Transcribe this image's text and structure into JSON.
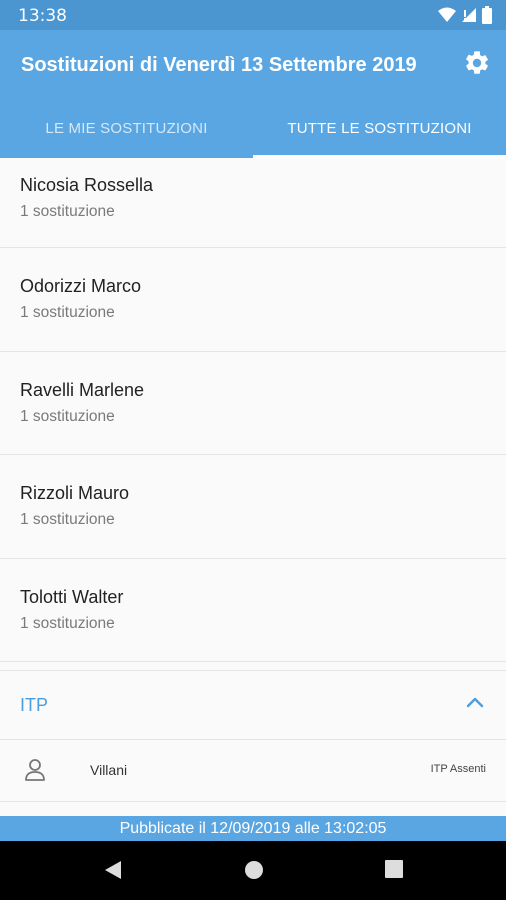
{
  "status_bar": {
    "time": "13:38",
    "icons": [
      "wifi-icon",
      "signal-icon",
      "battery-icon"
    ]
  },
  "app_bar": {
    "title": "Sostituzioni di Venerdì 13 Settembre 2019",
    "settings_icon": "gear-icon"
  },
  "tabs": [
    {
      "label": "LE MIE SOSTITUZIONI",
      "active": false
    },
    {
      "label": "TUTTE LE SOSTITUZIONI",
      "active": true
    }
  ],
  "teachers": [
    {
      "name": "Nicosia  Rossella",
      "count": "1 sostituzione"
    },
    {
      "name": "Odorizzi Marco",
      "count": "1 sostituzione"
    },
    {
      "name": "Ravelli Marlene",
      "count": "1 sostituzione"
    },
    {
      "name": "Rizzoli Mauro",
      "count": "1 sostituzione"
    },
    {
      "name": "Tolotti Walter",
      "count": "1 sostituzione"
    }
  ],
  "itp": {
    "title": "ITP",
    "rows": [
      {
        "name": "Villani",
        "status": "ITP Assenti"
      }
    ]
  },
  "footer": {
    "text": "Pubblicate il 12/09/2019 alle 13:02:05"
  },
  "colors": {
    "primary": "#5aa6e2",
    "status_bar": "#4b95d1",
    "accent_text": "#4a9ee0"
  }
}
